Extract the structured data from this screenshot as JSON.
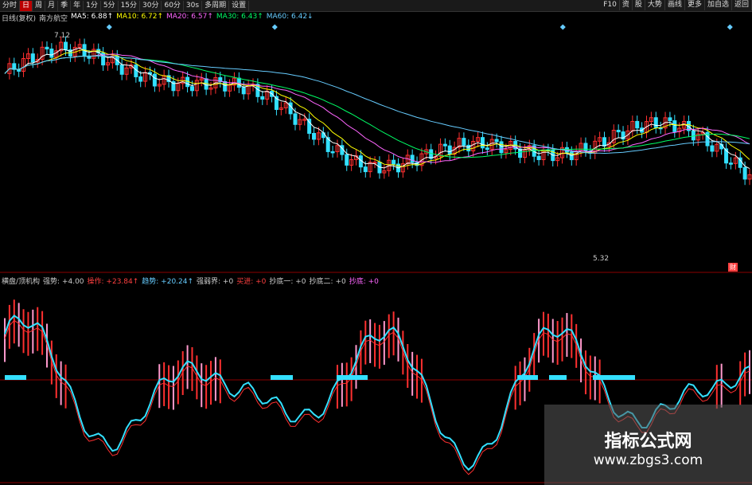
{
  "toolbar": {
    "left": [
      "分时",
      "日",
      "周",
      "月",
      "季",
      "年",
      "1分",
      "5分",
      "15分",
      "30分",
      "60分",
      "30s",
      "多周期",
      "设置"
    ],
    "active_index": 1,
    "right": [
      "F10",
      "资",
      "股",
      "大势",
      "画线",
      "更多",
      "加自选",
      "返回"
    ]
  },
  "info": [
    {
      "text": "日线(复权)",
      "color": "#cccccc"
    },
    {
      "text": "南方航空",
      "color": "#cccccc"
    },
    {
      "text": "MA5: 6.88↑",
      "color": "#ffffff"
    },
    {
      "text": "MA10: 6.72↑",
      "color": "#ffff00"
    },
    {
      "text": "MA20: 6.57↑",
      "color": "#ff66ff"
    },
    {
      "text": "MA30: 6.43↑",
      "color": "#00ff66"
    },
    {
      "text": "MA60: 6.42↓",
      "color": "#66ccff"
    }
  ],
  "indicator": [
    {
      "text": "横盘/顶机构",
      "color": "#cccccc"
    },
    {
      "text": "强势: +4.00",
      "color": "#cccccc"
    },
    {
      "text": "操作: +23.84↑",
      "color": "#ff4040"
    },
    {
      "text": "趋势: +20.24↑",
      "color": "#66ccff"
    },
    {
      "text": "强弱界: +0",
      "color": "#cccccc"
    },
    {
      "text": "买进: +0",
      "color": "#ff4040"
    },
    {
      "text": "抄底一: +0",
      "color": "#cccccc"
    },
    {
      "text": "抄底二: +0",
      "color": "#cccccc"
    },
    {
      "text": "抄底: +0",
      "color": "#ff66ff"
    }
  ],
  "price_high": "7.12",
  "price_low": "5.32",
  "chip_label": "财",
  "watermark": {
    "title": "指标公式网",
    "url": "www.zbgs3.com"
  },
  "colors": {
    "up": "#ff3030",
    "down": "#33e0ff",
    "ma5": "#ffffff",
    "ma10": "#ffff00",
    "ma20": "#ff66ff",
    "ma30": "#00ff66",
    "ma60": "#66ccff"
  }
}
